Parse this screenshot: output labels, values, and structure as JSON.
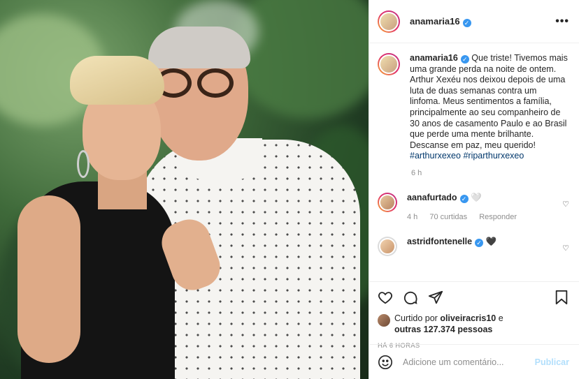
{
  "header": {
    "username": "anamaria16",
    "more_label": "•••"
  },
  "caption": {
    "username": "anamaria16",
    "text": "Que triste! Tivemos mais uma grande perda na noite de ontem. Arthur Xexéu nos deixou depois de uma luta de duas semanas contra um linfoma. Meus sentimentos a família, principalmente ao seu companheiro de 30 anos de casamento Paulo e ao Brasil que perde uma mente brilhante. Descanse em paz, meu querido!",
    "hashtag1": "#arthurxexeo",
    "hashtag2": "#riparthurxexeo",
    "time": "6 h"
  },
  "comments": [
    {
      "username": "aanafurtado",
      "text": "🤍",
      "time": "4 h",
      "likes": "70 curtidas",
      "reply": "Responder"
    },
    {
      "username": "astridfontenelle",
      "text": "🖤"
    }
  ],
  "likes": {
    "prefix": "Curtido por",
    "user": "oliveiracris10",
    "connector": "e",
    "others": "outras 127.374 pessoas"
  },
  "posted_ago": "HÁ 6 HORAS",
  "add_comment": {
    "placeholder": "Adicione um comentário...",
    "publish_label": "Publicar"
  },
  "colors": {
    "verified": "#3897f0",
    "hashtag": "#00376b",
    "publish": "#b2dffc"
  }
}
